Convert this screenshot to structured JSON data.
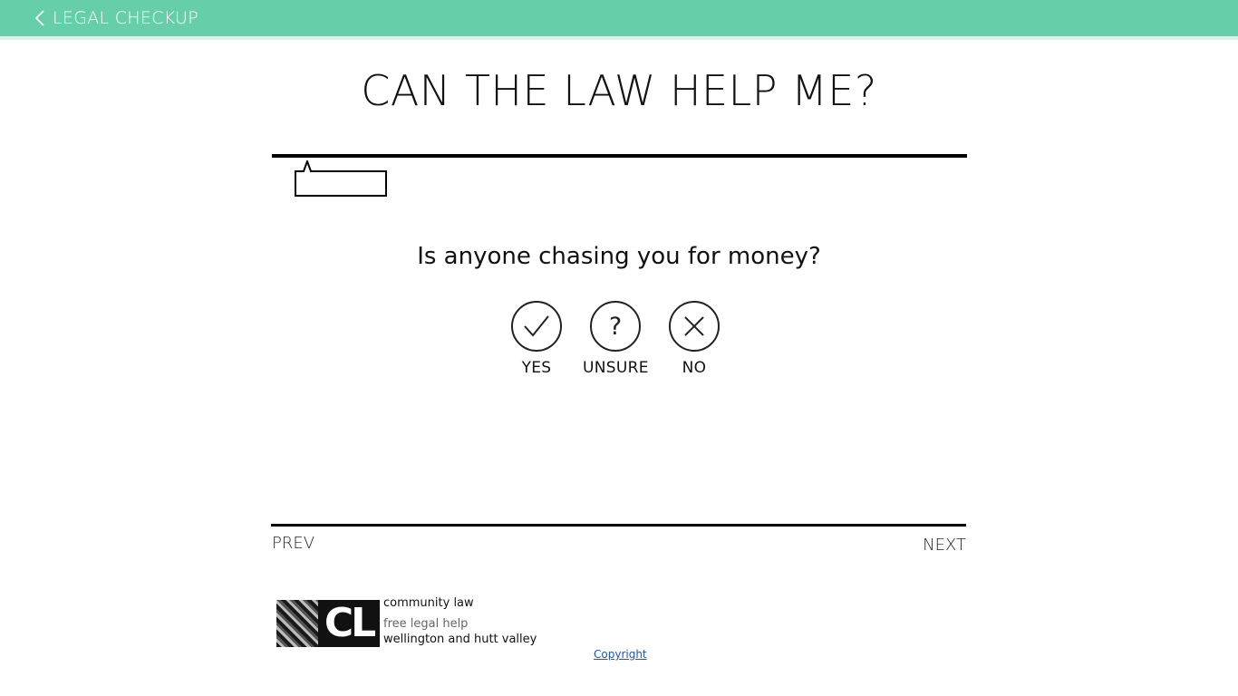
{
  "header": {
    "back_label": "LEGAL CHECKUP",
    "back_icon": "chevron-left-icon",
    "background_color": "#66cfaa"
  },
  "page": {
    "title": "CAN THE LAW HELP ME?"
  },
  "question": {
    "text": "Is anyone chasing you for money?"
  },
  "answers": [
    {
      "label": "YES",
      "icon": "check-icon"
    },
    {
      "label": "UNSURE",
      "icon": "question-icon"
    },
    {
      "label": "NO",
      "icon": "close-icon"
    }
  ],
  "navigation": {
    "prev_label": "PREV",
    "next_label": "NEXT"
  },
  "footer": {
    "logo_text": "CL",
    "org_name": "community law",
    "tagline": "free legal help",
    "region": "wellington and hutt valley",
    "copyright_label": "Copyright",
    "link_color": "#1a55c4"
  }
}
